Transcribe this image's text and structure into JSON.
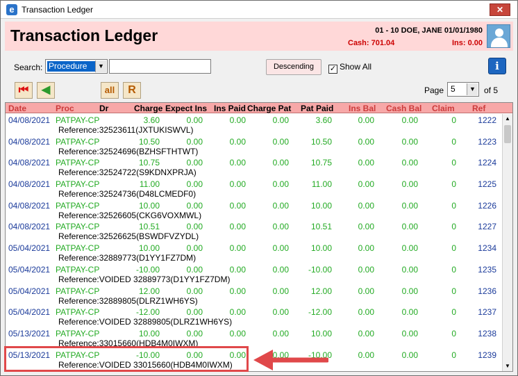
{
  "window": {
    "title": "Transaction Ledger",
    "close_glyph": "✕",
    "icon_letter": "e"
  },
  "header": {
    "title": "Transaction Ledger",
    "patient": "01 - 10 DOE, JANE 01/01/1980",
    "cash": "Cash: 701.04",
    "ins": "Ins: 0.00"
  },
  "search": {
    "label": "Search:",
    "field_value": "Procedure",
    "input_value": "",
    "order_button": "Descending",
    "show_all_label": "Show All",
    "show_all_checked": true
  },
  "toolbar": {
    "page_label": "Page",
    "page_value": "5",
    "page_total": "of 5",
    "all_label": "all",
    "r_label": "R"
  },
  "columns": [
    "Date",
    "Proc",
    "Dr",
    "Charge",
    "Expect Ins",
    "Ins Paid",
    "Charge Pat",
    "Pat Paid",
    "Ins Bal",
    "Cash Bal",
    "Claim",
    "Ref"
  ],
  "rows": [
    {
      "date": "04/08/2021",
      "proc": "PATPAY-CP",
      "charge": "3.60",
      "expect": "0.00",
      "inspaid": "0.00",
      "chargepat": "0.00",
      "patpaid": "3.60",
      "insbal": "0.00",
      "cashbal": "0.00",
      "claim": "0",
      "ref": "1222",
      "reference": "Reference:32523611(JXTUKISWVL)"
    },
    {
      "date": "04/08/2021",
      "proc": "PATPAY-CP",
      "charge": "10.50",
      "expect": "0.00",
      "inspaid": "0.00",
      "chargepat": "0.00",
      "patpaid": "10.50",
      "insbal": "0.00",
      "cashbal": "0.00",
      "claim": "0",
      "ref": "1223",
      "reference": "Reference:32524696(BZHSFTHTWT)"
    },
    {
      "date": "04/08/2021",
      "proc": "PATPAY-CP",
      "charge": "10.75",
      "expect": "0.00",
      "inspaid": "0.00",
      "chargepat": "0.00",
      "patpaid": "10.75",
      "insbal": "0.00",
      "cashbal": "0.00",
      "claim": "0",
      "ref": "1224",
      "reference": "Reference:32524722(S9KDNXPRJA)"
    },
    {
      "date": "04/08/2021",
      "proc": "PATPAY-CP",
      "charge": "11.00",
      "expect": "0.00",
      "inspaid": "0.00",
      "chargepat": "0.00",
      "patpaid": "11.00",
      "insbal": "0.00",
      "cashbal": "0.00",
      "claim": "0",
      "ref": "1225",
      "reference": "Reference:32524736(D48LCMEDF0)"
    },
    {
      "date": "04/08/2021",
      "proc": "PATPAY-CP",
      "charge": "10.00",
      "expect": "0.00",
      "inspaid": "0.00",
      "chargepat": "0.00",
      "patpaid": "10.00",
      "insbal": "0.00",
      "cashbal": "0.00",
      "claim": "0",
      "ref": "1226",
      "reference": "Reference:32526605(CKG6VOXMWL)"
    },
    {
      "date": "04/08/2021",
      "proc": "PATPAY-CP",
      "charge": "10.51",
      "expect": "0.00",
      "inspaid": "0.00",
      "chargepat": "0.00",
      "patpaid": "10.51",
      "insbal": "0.00",
      "cashbal": "0.00",
      "claim": "0",
      "ref": "1227",
      "reference": "Reference:32526625(BSWDFVZYDL)"
    },
    {
      "date": "05/04/2021",
      "proc": "PATPAY-CP",
      "charge": "10.00",
      "expect": "0.00",
      "inspaid": "0.00",
      "chargepat": "0.00",
      "patpaid": "10.00",
      "insbal": "0.00",
      "cashbal": "0.00",
      "claim": "0",
      "ref": "1234",
      "reference": "Reference:32889773(D1YY1FZ7DM)"
    },
    {
      "date": "05/04/2021",
      "proc": "PATPAY-CP",
      "charge": "-10.00",
      "expect": "0.00",
      "inspaid": "0.00",
      "chargepat": "0.00",
      "patpaid": "-10.00",
      "insbal": "0.00",
      "cashbal": "0.00",
      "claim": "0",
      "ref": "1235",
      "reference": "Reference:VOIDED 32889773(D1YY1FZ7DM)"
    },
    {
      "date": "05/04/2021",
      "proc": "PATPAY-CP",
      "charge": "12.00",
      "expect": "0.00",
      "inspaid": "0.00",
      "chargepat": "0.00",
      "patpaid": "12.00",
      "insbal": "0.00",
      "cashbal": "0.00",
      "claim": "0",
      "ref": "1236",
      "reference": "Reference:32889805(DLRZ1WH6YS)"
    },
    {
      "date": "05/04/2021",
      "proc": "PATPAY-CP",
      "charge": "-12.00",
      "expect": "0.00",
      "inspaid": "0.00",
      "chargepat": "0.00",
      "patpaid": "-12.00",
      "insbal": "0.00",
      "cashbal": "0.00",
      "claim": "0",
      "ref": "1237",
      "reference": "Reference:VOIDED 32889805(DLRZ1WH6YS)"
    },
    {
      "date": "05/13/2021",
      "proc": "PATPAY-CP",
      "charge": "10.00",
      "expect": "0.00",
      "inspaid": "0.00",
      "chargepat": "0.00",
      "patpaid": "10.00",
      "insbal": "0.00",
      "cashbal": "0.00",
      "claim": "0",
      "ref": "1238",
      "reference": "Reference:33015660(HDB4M0IWXM)"
    },
    {
      "date": "05/13/2021",
      "proc": "PATPAY-CP",
      "charge": "-10.00",
      "expect": "0.00",
      "inspaid": "0.00",
      "chargepat": "0.00",
      "patpaid": "-10.00",
      "insbal": "0.00",
      "cashbal": "0.00",
      "claim": "0",
      "ref": "1239",
      "reference": "Reference:VOIDED 33015660(HDB4M0IWXM)"
    }
  ],
  "colors": {
    "header_bg": "#ffd8d8",
    "col_header_bg": "#f7a8a8",
    "amount": "#22aa22",
    "date": "#1a3a9a",
    "alert": "#cc0000",
    "highlight": "#e0484a"
  }
}
